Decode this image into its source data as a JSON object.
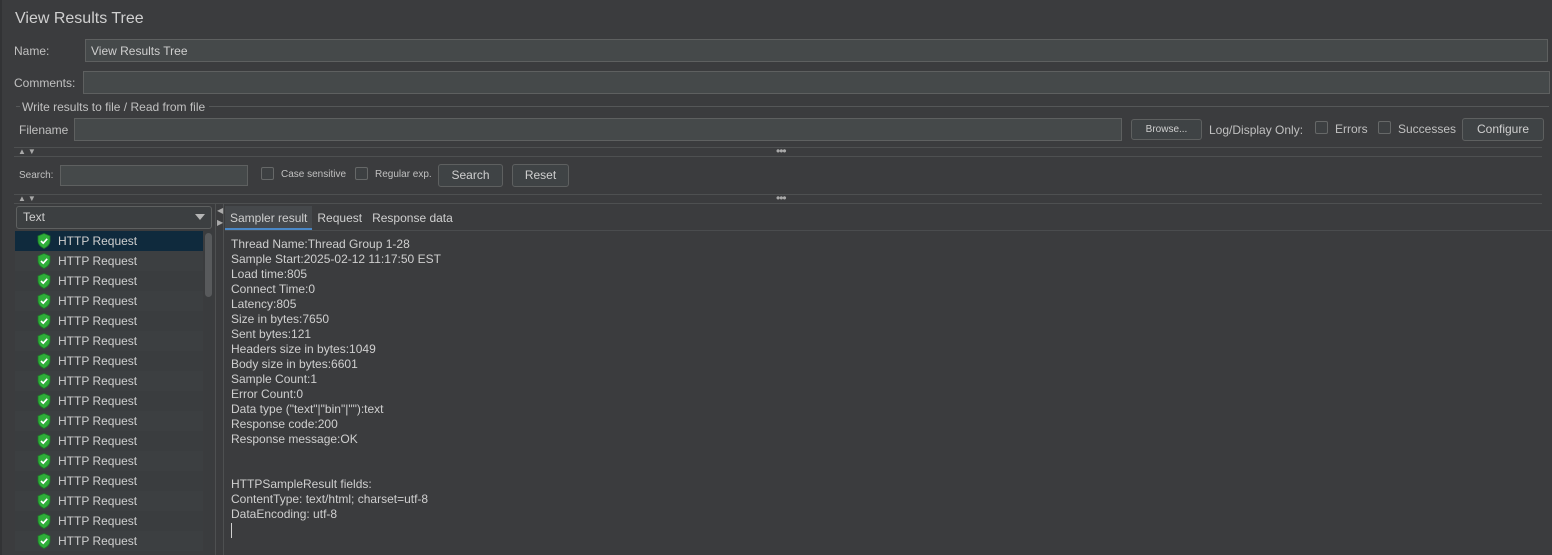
{
  "panel": {
    "title": "View Results Tree",
    "name_label": "Name:",
    "name_value": "View Results Tree",
    "comments_label": "Comments:",
    "comments_value": ""
  },
  "file_group": {
    "title": "Write results to file / Read from file",
    "filename_label": "Filename",
    "filename_value": "",
    "browse_label": "Browse...",
    "log_display_label": "Log/Display Only:",
    "errors_label": "Errors",
    "errors_checked": false,
    "successes_label": "Successes",
    "successes_checked": false,
    "configure_label": "Configure"
  },
  "search": {
    "label": "Search:",
    "value": "",
    "case_sensitive_label": "Case sensitive",
    "case_sensitive_checked": false,
    "regex_label": "Regular exp.",
    "regex_checked": false,
    "search_button": "Search",
    "reset_button": "Reset"
  },
  "renderer": {
    "selected": "Text"
  },
  "tree": {
    "items": [
      {
        "label": "HTTP Request",
        "status": "success",
        "selected": true
      },
      {
        "label": "HTTP Request",
        "status": "success"
      },
      {
        "label": "HTTP Request",
        "status": "success"
      },
      {
        "label": "HTTP Request",
        "status": "success"
      },
      {
        "label": "HTTP Request",
        "status": "success"
      },
      {
        "label": "HTTP Request",
        "status": "success"
      },
      {
        "label": "HTTP Request",
        "status": "success"
      },
      {
        "label": "HTTP Request",
        "status": "success"
      },
      {
        "label": "HTTP Request",
        "status": "success"
      },
      {
        "label": "HTTP Request",
        "status": "success"
      },
      {
        "label": "HTTP Request",
        "status": "success"
      },
      {
        "label": "HTTP Request",
        "status": "success"
      },
      {
        "label": "HTTP Request",
        "status": "success"
      },
      {
        "label": "HTTP Request",
        "status": "success"
      },
      {
        "label": "HTTP Request",
        "status": "success"
      },
      {
        "label": "HTTP Request",
        "status": "success"
      }
    ]
  },
  "tabs": [
    {
      "label": "Sampler result",
      "active": true
    },
    {
      "label": "Request",
      "active": false
    },
    {
      "label": "Response data",
      "active": false
    }
  ],
  "sampler_result": {
    "lines": [
      "Thread Name:Thread Group 1-28",
      "Sample Start:2025-02-12 11:17:50 EST",
      "Load time:805",
      "Connect Time:0",
      "Latency:805",
      "Size in bytes:7650",
      "Sent bytes:121",
      "Headers size in bytes:1049",
      "Body size in bytes:6601",
      "Sample Count:1",
      "Error Count:0",
      "Data type (\"text\"|\"bin\"|\"\"):text",
      "Response code:200",
      "Response message:OK",
      "",
      "",
      "HTTPSampleResult fields:",
      "ContentType: text/html; charset=utf-8",
      "DataEncoding: utf-8"
    ]
  },
  "colors": {
    "background": "#3b3c3e",
    "accent": "#4a88c7",
    "selected_row": "#0f2a3d",
    "success_icon": "#2fae3a"
  }
}
